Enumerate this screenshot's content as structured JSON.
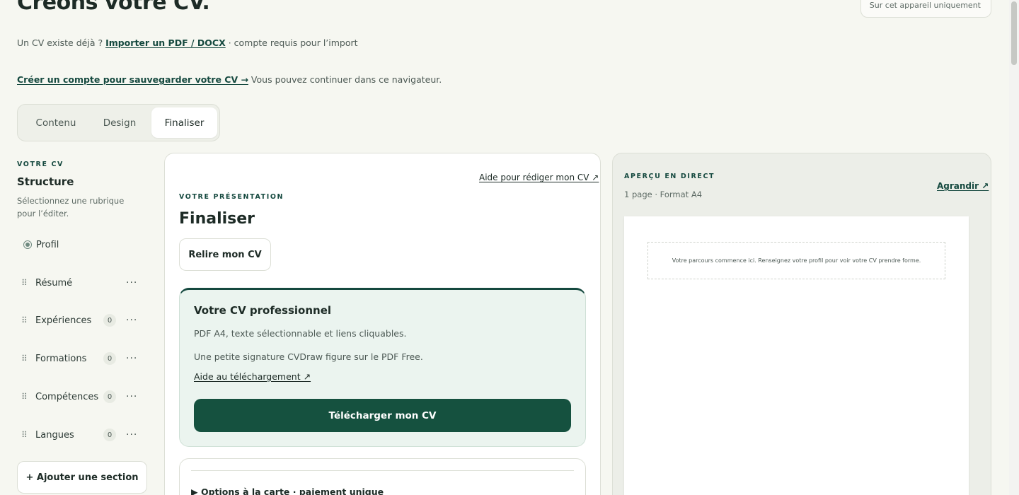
{
  "page": {
    "title": "Créons votre CV.",
    "device_badge": "Sur cet appareil uniquement"
  },
  "import": {
    "prefix": "Un CV existe déjà ? ",
    "link": "Importer un PDF / DOCX",
    "suffix": " · compte requis pour l’import"
  },
  "account": {
    "link": "Créer un compte pour sauvegarder votre CV →",
    "suffix": " Vous pouvez continuer dans ce navigateur."
  },
  "tabs": [
    {
      "label": "Contenu",
      "active": false
    },
    {
      "label": "Design",
      "active": false
    },
    {
      "label": "Finaliser",
      "active": true
    }
  ],
  "sidebar": {
    "eyebrow": "VOTRE CV",
    "title": "Structure",
    "hint": "Sélectionnez une rubrique pour l’éditer.",
    "items": [
      {
        "label": "Profil"
      },
      {
        "label": "Résumé",
        "more": "···"
      },
      {
        "label": "Expériences",
        "count": "0",
        "more": "···"
      },
      {
        "label": "Formations",
        "count": "0",
        "more": "···"
      },
      {
        "label": "Compétences",
        "count": "0",
        "more": "···"
      },
      {
        "label": "Langues",
        "count": "0",
        "more": "···"
      }
    ],
    "add_section": "+ Ajouter une section"
  },
  "main": {
    "help_link": "Aide pour rédiger mon CV ↗",
    "eyebrow": "VOTRE PRÉSENTATION",
    "title": "Finaliser",
    "reread_button": "Relire mon CV",
    "pro_card": {
      "title": "Votre CV professionnel",
      "line1": "PDF A4, texte sélectionnable et liens cliquables.",
      "line2": "Une petite signature CVDraw figure sur le PDF Free.",
      "help_link": "Aide au téléchargement ↗",
      "download_button": "Télécharger mon CV"
    },
    "options": {
      "summary": "▶ Options à la carte · paiement unique"
    }
  },
  "preview": {
    "eyebrow": "APERÇU EN DIRECT",
    "meta": "1 page · Format A4",
    "enlarge": "Agrandir ↗",
    "placeholder": "Votre parcours commence ici. Renseignez votre profil pour voir votre CV prendre forme."
  },
  "colors": {
    "accent": "#15493f",
    "download_bg": "#15513f",
    "page_bg": "#f6f7f1",
    "pro_card_bg": "#ebf4ef"
  }
}
